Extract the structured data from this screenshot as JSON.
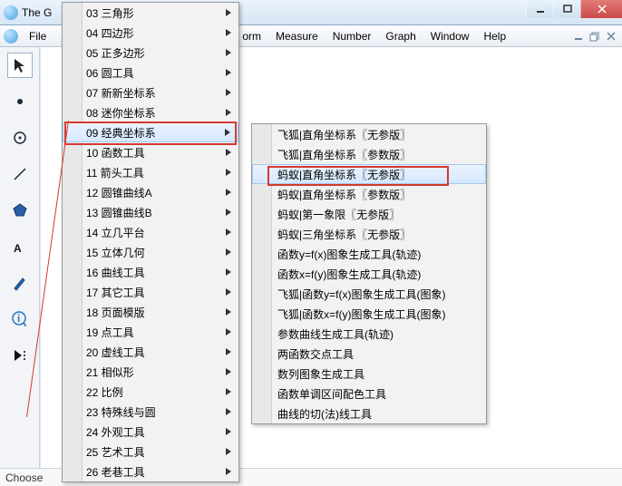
{
  "window": {
    "title_prefix": "The G"
  },
  "menubar": {
    "items": [
      "File",
      "orm",
      "Measure",
      "Number",
      "Graph",
      "Window",
      "Help"
    ]
  },
  "statusbar": {
    "text": "Choose"
  },
  "dropdown": {
    "hi_index": 6,
    "items": [
      "03 三角形",
      "04 四边形",
      "05 正多边形",
      "06 圆工具",
      "07 新新坐标系",
      "08 迷你坐标系",
      "09 经典坐标系",
      "10 函数工具",
      "11 箭头工具",
      "12 圆锥曲线A",
      "13 圆锥曲线B",
      "14 立几平台",
      "15 立体几何",
      "16 曲线工具",
      "17 其它工具",
      "18 页面模版",
      "19 点工具",
      "20 虚线工具",
      "21 相似形",
      "22 比例",
      "23 特殊线与圆",
      "24 外观工具",
      "25 艺术工具",
      "26 老巷工具"
    ]
  },
  "submenu": {
    "hi_index": 2,
    "items": [
      "飞狐|直角坐标系〖无参版〗",
      "飞狐|直角坐标系〖参数版〗",
      "蚂蚁|直角坐标系〖无参版〗",
      "蚂蚁|直角坐标系〖参数版〗",
      "蚂蚁|第一象限〖无参版〗",
      "蚂蚁|三角坐标系〖无参版〗",
      "函数y=f(x)图象生成工具(轨迹)",
      "函数x=f(y)图象生成工具(轨迹)",
      "飞狐|函数y=f(x)图象生成工具(图象)",
      "飞狐|函数x=f(y)图象生成工具(图象)",
      "参数曲线生成工具(轨迹)",
      "两函数交点工具",
      "数列图象生成工具",
      "函数单调区间配色工具",
      "曲线的切(法)线工具"
    ]
  }
}
